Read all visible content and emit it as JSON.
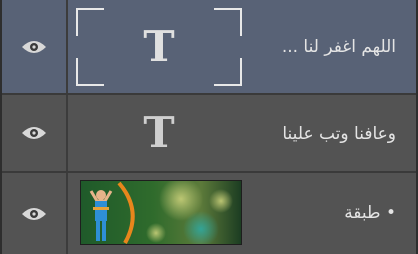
{
  "layers_panel": {
    "layers": [
      {
        "name": "اللهم اغفر لنا ...",
        "type": "text",
        "thumbnail_glyph": "T",
        "visible": true,
        "selected": true,
        "eye_icon": "eye-icon"
      },
      {
        "name": "وعافنا وتب علينا",
        "type": "text",
        "thumbnail_glyph": "T",
        "visible": true,
        "selected": false,
        "eye_icon": "eye-icon"
      },
      {
        "name": "• طبقة",
        "type": "image",
        "visible": true,
        "selected": false,
        "eye_icon": "eye-icon"
      }
    ]
  },
  "colors": {
    "panel_bg": "#535353",
    "selected_bg": "#586276",
    "separator": "#3a3a3a",
    "text": "#e4e4e4"
  }
}
